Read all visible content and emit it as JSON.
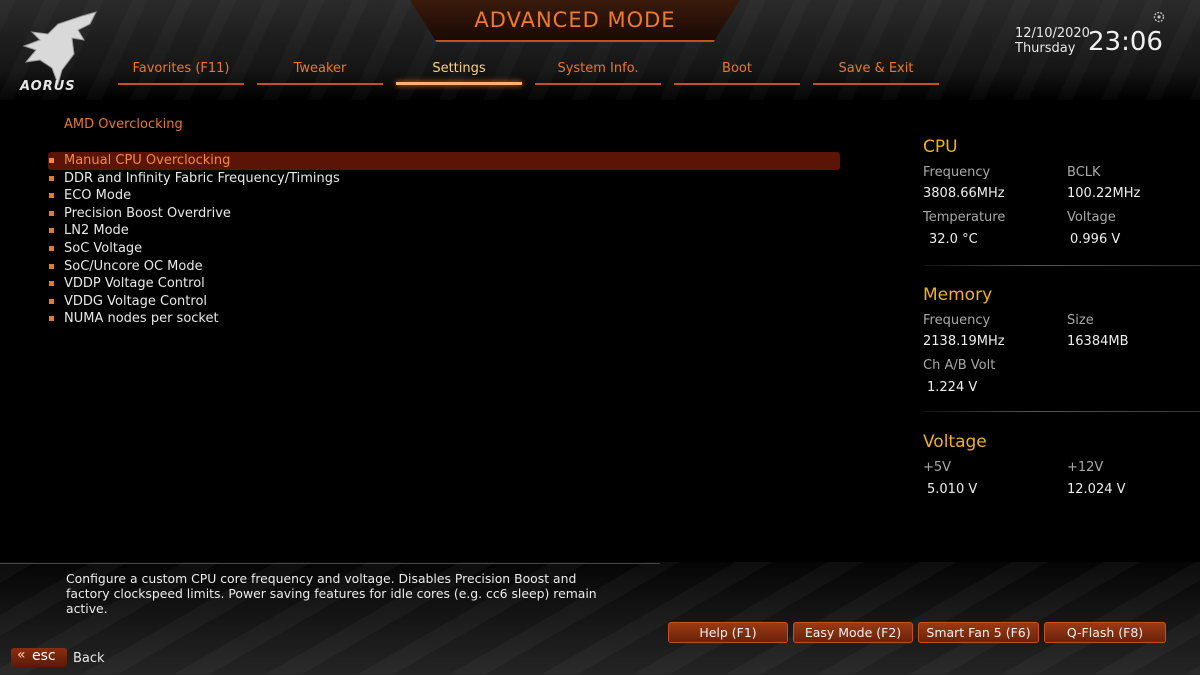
{
  "header": {
    "title": "ADVANCED MODE",
    "brand": "AORUS",
    "date": "12/10/2020",
    "weekday": "Thursday",
    "time": "23:06"
  },
  "tabs": [
    {
      "label": "Favorites (F11)"
    },
    {
      "label": "Tweaker"
    },
    {
      "label": "Settings",
      "active": true
    },
    {
      "label": "System Info."
    },
    {
      "label": "Boot"
    },
    {
      "label": "Save & Exit"
    }
  ],
  "main": {
    "section_title": "AMD Overclocking",
    "items": [
      {
        "label": "Manual CPU Overclocking",
        "selected": true
      },
      {
        "label": "DDR and Infinity Fabric Frequency/Timings"
      },
      {
        "label": "ECO Mode"
      },
      {
        "label": "Precision Boost Overdrive"
      },
      {
        "label": "LN2 Mode"
      },
      {
        "label": "SoC Voltage"
      },
      {
        "label": "SoC/Uncore OC Mode"
      },
      {
        "label": "VDDP Voltage Control"
      },
      {
        "label": "VDDG Voltage Control"
      },
      {
        "label": "NUMA nodes per socket"
      }
    ]
  },
  "sidepanel": {
    "cpu": {
      "title": "CPU",
      "freq_label": "Frequency",
      "freq_value": "3808.66MHz",
      "bclk_label": "BCLK",
      "bclk_value": "100.22MHz",
      "temp_label": "Temperature",
      "temp_value": "32.0 °C",
      "volt_label": "Voltage",
      "volt_value": "0.996 V"
    },
    "memory": {
      "title": "Memory",
      "freq_label": "Frequency",
      "freq_value": "2138.19MHz",
      "size_label": "Size",
      "size_value": "16384MB",
      "chvolt_label": "Ch A/B Volt",
      "chvolt_value": "1.224 V"
    },
    "voltage": {
      "title": "Voltage",
      "v5_label": "+5V",
      "v5_value": "5.010 V",
      "v12_label": "+12V",
      "v12_value": "12.024 V"
    }
  },
  "help": {
    "text": "Configure a custom CPU core frequency and voltage. Disables Precision Boost and factory clockspeed limits. Power saving features for idle cores (e.g. cc6 sleep) remain active."
  },
  "footer": {
    "buttons": [
      {
        "label": "Help (F1)"
      },
      {
        "label": "Easy Mode (F2)"
      },
      {
        "label": "Smart Fan 5 (F6)"
      },
      {
        "label": "Q-Flash (F8)"
      }
    ],
    "esc_label": "esc",
    "back_label": "Back"
  },
  "colors": {
    "accent": "#e9782f",
    "selected_bg": "#5b1406",
    "panel_heading": "#f0b020"
  }
}
